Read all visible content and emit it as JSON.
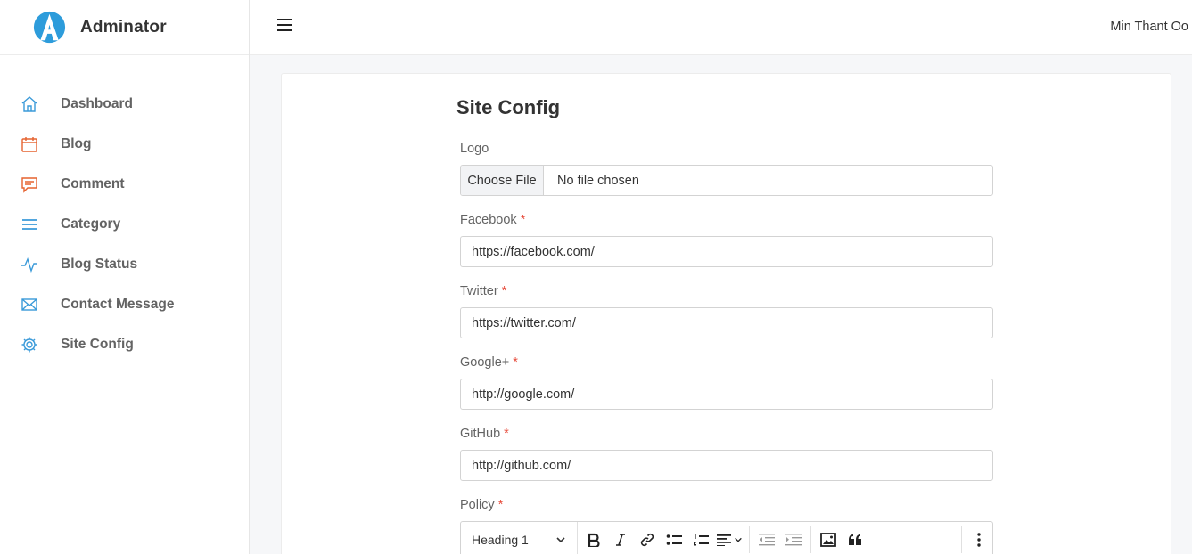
{
  "app": {
    "brand": "Adminator",
    "user": "Min Thant Oo"
  },
  "sidebar": {
    "items": [
      {
        "label": "Dashboard",
        "icon": "home-icon",
        "color": "#3a9ad9"
      },
      {
        "label": "Blog",
        "icon": "calendar-icon",
        "color": "#e5622f"
      },
      {
        "label": "Comment",
        "icon": "comment-icon",
        "color": "#e5622f"
      },
      {
        "label": "Category",
        "icon": "list-icon",
        "color": "#3a9ad9"
      },
      {
        "label": "Blog Status",
        "icon": "pulse-icon",
        "color": "#3a9ad9"
      },
      {
        "label": "Contact Message",
        "icon": "mail-icon",
        "color": "#3a9ad9"
      },
      {
        "label": "Site Config",
        "icon": "gear-icon",
        "color": "#3a9ad9"
      }
    ]
  },
  "page": {
    "title": "Site Config"
  },
  "form": {
    "logo": {
      "label": "Logo",
      "button": "Choose File",
      "status": "No file chosen"
    },
    "facebook": {
      "label": "Facebook",
      "value": "https://facebook.com/"
    },
    "twitter": {
      "label": "Twitter",
      "value": "https://twitter.com/"
    },
    "google": {
      "label": "Google+",
      "value": "http://google.com/"
    },
    "github": {
      "label": "GitHub",
      "value": "http://github.com/"
    },
    "policy": {
      "label": "Policy",
      "heading": "Heading 1"
    },
    "required_mark": "*"
  },
  "colors": {
    "accent": "#3a9ad9",
    "orange": "#e5622f",
    "required": "#e74c3c"
  }
}
